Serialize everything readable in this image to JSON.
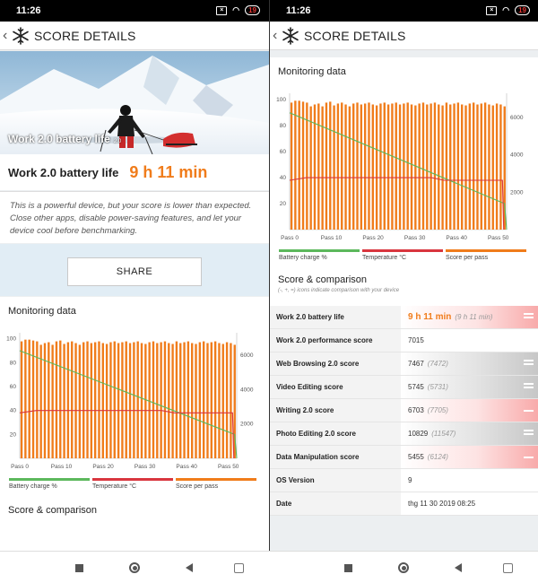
{
  "status": {
    "time": "11:26",
    "battery": "19"
  },
  "appbar": {
    "title": "SCORE DETAILS"
  },
  "hero": {
    "caption": "Work 2.0 battery life",
    "caption_suffix": "2.0"
  },
  "score": {
    "label": "Work 2.0 battery life",
    "value": "9 h 11 min"
  },
  "description": "This is a powerful device, but your score is lower than expected. Close other apps, disable power-saving features, and let your device cool before benchmarking.",
  "share_label": "SHARE",
  "monitoring": {
    "title": "Monitoring data"
  },
  "legend": [
    {
      "label": "Battery charge %",
      "color": "#5cb85c"
    },
    {
      "label": "Temperature °C",
      "color": "#d9363e"
    },
    {
      "label": "Score per pass",
      "color": "#f07c1b"
    }
  ],
  "comparison": {
    "title": "Score & comparison",
    "subtitle": "(-, +, =) icons indicate comparison with your device",
    "rows": [
      {
        "label": "Work 2.0 battery life",
        "value": "9 h 11 min",
        "prev": "(9 h 11 min)",
        "style": "red",
        "icon": "equal-icon",
        "highlight": true
      },
      {
        "label": "Work 2.0 performance score",
        "value": "7015",
        "prev": "",
        "style": "none",
        "icon": ""
      },
      {
        "label": "Web Browsing 2.0 score",
        "value": "7467",
        "prev": "(7472)",
        "style": "gray",
        "icon": "equal-icon"
      },
      {
        "label": "Video Editing score",
        "value": "5745",
        "prev": "(5731)",
        "style": "gray",
        "icon": "equal-icon"
      },
      {
        "label": "Writing 2.0 score",
        "value": "6703",
        "prev": "(7705)",
        "style": "red",
        "icon": "minus-icon"
      },
      {
        "label": "Photo Editing 2.0 score",
        "value": "10829",
        "prev": "(11547)",
        "style": "gray",
        "icon": "equal-icon"
      },
      {
        "label": "Data Manipulation score",
        "value": "5455",
        "prev": "(6124)",
        "style": "red",
        "icon": "minus-icon"
      },
      {
        "label": "OS Version",
        "value": "9",
        "prev": "",
        "style": "none",
        "icon": ""
      },
      {
        "label": "Date",
        "value": "thg 11 30 2019 08:25",
        "prev": "",
        "style": "none",
        "icon": ""
      }
    ]
  },
  "chart_data": {
    "type": "bar",
    "x_ticks": [
      "Pass 0",
      "Pass 10",
      "Pass 20",
      "Pass 30",
      "Pass 40",
      "Pass 50"
    ],
    "y_left_ticks": [
      "100",
      "80",
      "60",
      "40",
      "20"
    ],
    "y_right_ticks": [
      "6000",
      "4000",
      "2000"
    ],
    "y_left_range": [
      0,
      100
    ],
    "y_right_range": [
      0,
      7000
    ],
    "series": [
      {
        "name": "Score per pass",
        "axis": "right",
        "color": "#f07c1b",
        "values": [
          6800,
          6900,
          6900,
          6850,
          6800,
          6600,
          6700,
          6750,
          6600,
          6800,
          6850,
          6650,
          6750,
          6800,
          6700,
          6600,
          6750,
          6800,
          6700,
          6750,
          6800,
          6700,
          6650,
          6750,
          6800,
          6700,
          6750,
          6800,
          6700,
          6750,
          6800,
          6700,
          6650,
          6750,
          6800,
          6700,
          6750,
          6800,
          6700,
          6650,
          6800,
          6700,
          6750,
          6800,
          6700,
          6650,
          6750,
          6800,
          6700,
          6750,
          6800,
          6700,
          6650,
          6750,
          6700,
          6600
        ]
      },
      {
        "name": "Battery charge %",
        "axis": "left",
        "color": "#5cb85c",
        "x": [
          0,
          51.5,
          52
        ],
        "y": [
          90,
          20,
          0
        ]
      },
      {
        "name": "Temperature °C",
        "axis": "left",
        "color": "#d9363e",
        "x": [
          0,
          4,
          34,
          37,
          51,
          51.3
        ],
        "y": [
          38,
          40,
          40,
          38,
          38,
          0
        ]
      }
    ]
  }
}
